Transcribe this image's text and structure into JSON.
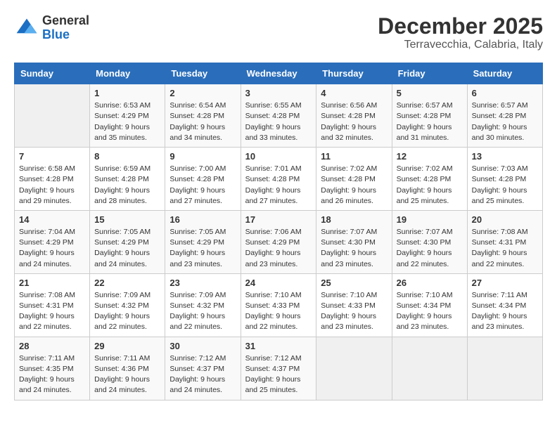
{
  "header": {
    "logo_general": "General",
    "logo_blue": "Blue",
    "month_title": "December 2025",
    "location": "Terravecchia, Calabria, Italy"
  },
  "weekdays": [
    "Sunday",
    "Monday",
    "Tuesday",
    "Wednesday",
    "Thursday",
    "Friday",
    "Saturday"
  ],
  "weeks": [
    [
      {
        "day": "",
        "info": ""
      },
      {
        "day": "1",
        "info": "Sunrise: 6:53 AM\nSunset: 4:29 PM\nDaylight: 9 hours\nand 35 minutes."
      },
      {
        "day": "2",
        "info": "Sunrise: 6:54 AM\nSunset: 4:28 PM\nDaylight: 9 hours\nand 34 minutes."
      },
      {
        "day": "3",
        "info": "Sunrise: 6:55 AM\nSunset: 4:28 PM\nDaylight: 9 hours\nand 33 minutes."
      },
      {
        "day": "4",
        "info": "Sunrise: 6:56 AM\nSunset: 4:28 PM\nDaylight: 9 hours\nand 32 minutes."
      },
      {
        "day": "5",
        "info": "Sunrise: 6:57 AM\nSunset: 4:28 PM\nDaylight: 9 hours\nand 31 minutes."
      },
      {
        "day": "6",
        "info": "Sunrise: 6:57 AM\nSunset: 4:28 PM\nDaylight: 9 hours\nand 30 minutes."
      }
    ],
    [
      {
        "day": "7",
        "info": "Sunrise: 6:58 AM\nSunset: 4:28 PM\nDaylight: 9 hours\nand 29 minutes."
      },
      {
        "day": "8",
        "info": "Sunrise: 6:59 AM\nSunset: 4:28 PM\nDaylight: 9 hours\nand 28 minutes."
      },
      {
        "day": "9",
        "info": "Sunrise: 7:00 AM\nSunset: 4:28 PM\nDaylight: 9 hours\nand 27 minutes."
      },
      {
        "day": "10",
        "info": "Sunrise: 7:01 AM\nSunset: 4:28 PM\nDaylight: 9 hours\nand 27 minutes."
      },
      {
        "day": "11",
        "info": "Sunrise: 7:02 AM\nSunset: 4:28 PM\nDaylight: 9 hours\nand 26 minutes."
      },
      {
        "day": "12",
        "info": "Sunrise: 7:02 AM\nSunset: 4:28 PM\nDaylight: 9 hours\nand 25 minutes."
      },
      {
        "day": "13",
        "info": "Sunrise: 7:03 AM\nSunset: 4:28 PM\nDaylight: 9 hours\nand 25 minutes."
      }
    ],
    [
      {
        "day": "14",
        "info": "Sunrise: 7:04 AM\nSunset: 4:29 PM\nDaylight: 9 hours\nand 24 minutes."
      },
      {
        "day": "15",
        "info": "Sunrise: 7:05 AM\nSunset: 4:29 PM\nDaylight: 9 hours\nand 24 minutes."
      },
      {
        "day": "16",
        "info": "Sunrise: 7:05 AM\nSunset: 4:29 PM\nDaylight: 9 hours\nand 23 minutes."
      },
      {
        "day": "17",
        "info": "Sunrise: 7:06 AM\nSunset: 4:29 PM\nDaylight: 9 hours\nand 23 minutes."
      },
      {
        "day": "18",
        "info": "Sunrise: 7:07 AM\nSunset: 4:30 PM\nDaylight: 9 hours\nand 23 minutes."
      },
      {
        "day": "19",
        "info": "Sunrise: 7:07 AM\nSunset: 4:30 PM\nDaylight: 9 hours\nand 22 minutes."
      },
      {
        "day": "20",
        "info": "Sunrise: 7:08 AM\nSunset: 4:31 PM\nDaylight: 9 hours\nand 22 minutes."
      }
    ],
    [
      {
        "day": "21",
        "info": "Sunrise: 7:08 AM\nSunset: 4:31 PM\nDaylight: 9 hours\nand 22 minutes."
      },
      {
        "day": "22",
        "info": "Sunrise: 7:09 AM\nSunset: 4:32 PM\nDaylight: 9 hours\nand 22 minutes."
      },
      {
        "day": "23",
        "info": "Sunrise: 7:09 AM\nSunset: 4:32 PM\nDaylight: 9 hours\nand 22 minutes."
      },
      {
        "day": "24",
        "info": "Sunrise: 7:10 AM\nSunset: 4:33 PM\nDaylight: 9 hours\nand 22 minutes."
      },
      {
        "day": "25",
        "info": "Sunrise: 7:10 AM\nSunset: 4:33 PM\nDaylight: 9 hours\nand 23 minutes."
      },
      {
        "day": "26",
        "info": "Sunrise: 7:10 AM\nSunset: 4:34 PM\nDaylight: 9 hours\nand 23 minutes."
      },
      {
        "day": "27",
        "info": "Sunrise: 7:11 AM\nSunset: 4:34 PM\nDaylight: 9 hours\nand 23 minutes."
      }
    ],
    [
      {
        "day": "28",
        "info": "Sunrise: 7:11 AM\nSunset: 4:35 PM\nDaylight: 9 hours\nand 24 minutes."
      },
      {
        "day": "29",
        "info": "Sunrise: 7:11 AM\nSunset: 4:36 PM\nDaylight: 9 hours\nand 24 minutes."
      },
      {
        "day": "30",
        "info": "Sunrise: 7:12 AM\nSunset: 4:37 PM\nDaylight: 9 hours\nand 24 minutes."
      },
      {
        "day": "31",
        "info": "Sunrise: 7:12 AM\nSunset: 4:37 PM\nDaylight: 9 hours\nand 25 minutes."
      },
      {
        "day": "",
        "info": ""
      },
      {
        "day": "",
        "info": ""
      },
      {
        "day": "",
        "info": ""
      }
    ]
  ]
}
